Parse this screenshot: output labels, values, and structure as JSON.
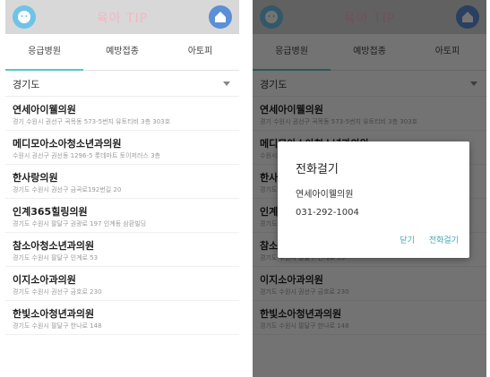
{
  "app": {
    "title": "육아 TIP"
  },
  "tabs": [
    "응급병원",
    "예방접종",
    "아토피"
  ],
  "region": "경기도",
  "hospitals": [
    {
      "name": "연세아이웰의원",
      "address": "경기 수원시 권선구 곡목동 573-5번지 유토티비 3층 303호"
    },
    {
      "name": "메디모아소아청소년과의원",
      "address": "수원시 권선구 권선동 1296-5 롯데마트 토이저러스 3층"
    },
    {
      "name": "한사랑의원",
      "address": "경기도 수원시 권선구 금곡로192번길 20"
    },
    {
      "name": "인계365힐링의원",
      "address": "경기도 수원시 팔달구 권광로 197 인계동 삼환빌딩"
    },
    {
      "name": "참소아청소년과의원",
      "address": "경기도 수원시 팔달구 인계로 53"
    },
    {
      "name": "이지소아과의원",
      "address": "경기도 수원시 권선구 금호로 230"
    },
    {
      "name": "한빛소아청년과의원",
      "address": "경기도 수원시 팔달구 한나로 148"
    }
  ],
  "dialog": {
    "title": "전화걸기",
    "name": "연세아이웰의원",
    "phone": "031-292-1004",
    "cancel": "닫기",
    "call": "전화걸기"
  },
  "colors": {
    "appbar": "#d8d8d8",
    "accent": "#5bc2c8",
    "title": "#f6b5c3"
  },
  "icons": {
    "left": "baby-icon",
    "right": "home-icon"
  }
}
